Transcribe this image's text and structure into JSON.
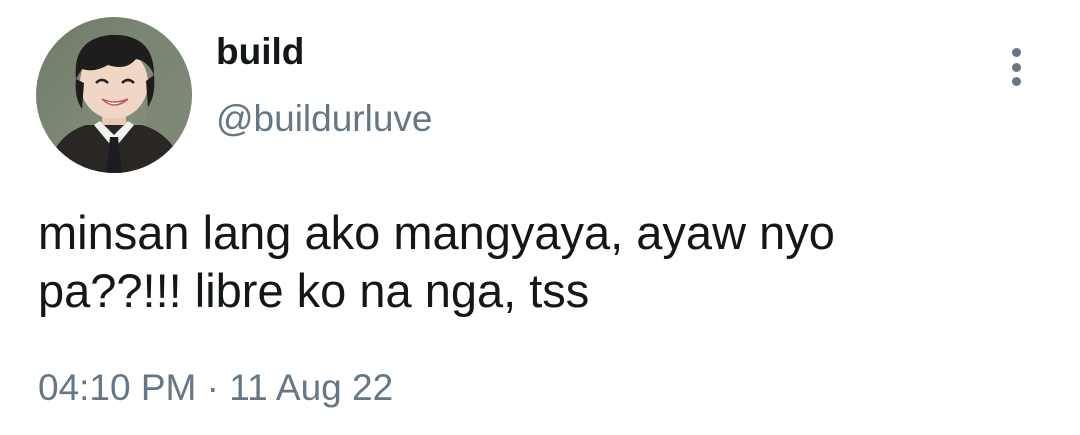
{
  "tweet": {
    "author": {
      "display_name": "build",
      "handle": "@buildurluve"
    },
    "text": "minsan lang ako mangyaya, ayaw nyo\npa??!!! libre ko na nga, tss",
    "time": "04:10 PM",
    "separator": " · ",
    "date": "11 Aug 22",
    "more_icon": "vertical-ellipsis-icon"
  },
  "colors": {
    "text_primary": "#14171a",
    "text_secondary": "#657786",
    "background": "#ffffff"
  }
}
